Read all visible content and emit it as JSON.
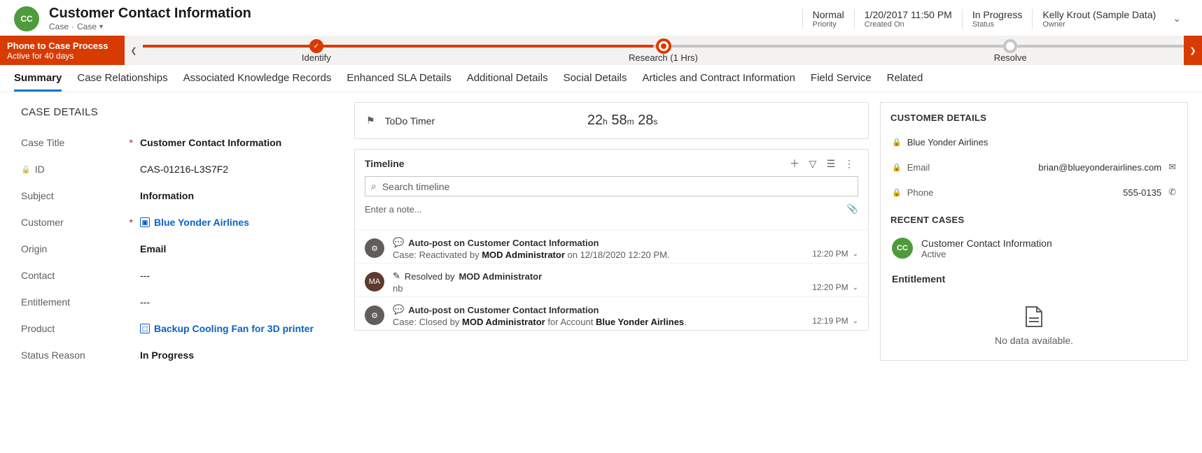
{
  "header": {
    "avatar": "CC",
    "title": "Customer Contact Information",
    "subtitle_a": "Case",
    "subtitle_b": "Case",
    "priority_value": "Normal",
    "priority_label": "Priority",
    "created_value": "1/20/2017 11:50 PM",
    "created_label": "Created On",
    "status_value": "In Progress",
    "status_label": "Status",
    "owner_value": "Kelly Krout (Sample Data)",
    "owner_label": "Owner"
  },
  "process": {
    "name": "Phone to Case Process",
    "duration": "Active for 40 days",
    "stages": {
      "identify": "Identify",
      "research": "Research  (1 Hrs)",
      "resolve": "Resolve"
    }
  },
  "tabs": [
    "Summary",
    "Case Relationships",
    "Associated Knowledge Records",
    "Enhanced SLA Details",
    "Additional Details",
    "Social Details",
    "Articles and Contract Information",
    "Field Service",
    "Related"
  ],
  "case_details": {
    "heading": "CASE DETAILS",
    "rows": {
      "case_title_label": "Case Title",
      "case_title_value": "Customer Contact Information",
      "id_label": "ID",
      "id_value": "CAS-01216-L3S7F2",
      "subject_label": "Subject",
      "subject_value": "Information",
      "customer_label": "Customer",
      "customer_value": "Blue Yonder Airlines",
      "origin_label": "Origin",
      "origin_value": "Email",
      "contact_label": "Contact",
      "contact_value": "---",
      "entitlement_label": "Entitlement",
      "entitlement_value": "---",
      "product_label": "Product",
      "product_value": "Backup Cooling Fan for 3D printer",
      "status_reason_label": "Status Reason",
      "status_reason_value": "In Progress"
    }
  },
  "timer": {
    "label": "ToDo Timer",
    "h": "22",
    "m": "58",
    "s": "28",
    "hu": "h",
    "mu": "m",
    "su": "s"
  },
  "timeline": {
    "title": "Timeline",
    "search_placeholder": "Search timeline",
    "note_placeholder": "Enter a note...",
    "items": [
      {
        "avatar_type": "sys",
        "avatar": "⚙",
        "title": "Auto-post on Customer Contact Information",
        "line_prefix": "Case: Reactivated by ",
        "line_bold": "MOD Administrator",
        "line_suffix": " on 12/18/2020 12:20 PM.",
        "time": "12:20 PM"
      },
      {
        "avatar_type": "user",
        "avatar": "MA",
        "title_prefix": "Resolved by ",
        "title_bold": "MOD Administrator",
        "line": "nb",
        "time": "12:20 PM"
      },
      {
        "avatar_type": "sys",
        "avatar": "⚙",
        "title": "Auto-post on Customer Contact Information",
        "line_prefix": "Case: Closed by ",
        "line_bold": "MOD Administrator",
        "line_mid": " for Account ",
        "line_bold2": "Blue Yonder Airlines",
        "line_suffix": ".",
        "time": "12:19 PM"
      }
    ]
  },
  "customer_details": {
    "heading": "CUSTOMER DETAILS",
    "name": "Blue Yonder Airlines",
    "email_label": "Email",
    "email_value": "brian@blueyonderairlines.com",
    "phone_label": "Phone",
    "phone_value": "555-0135",
    "recent_heading": "RECENT CASES",
    "recent_title": "Customer Contact Information",
    "recent_status": "Active",
    "entitlement_heading": "Entitlement",
    "nodata": "No data available."
  }
}
